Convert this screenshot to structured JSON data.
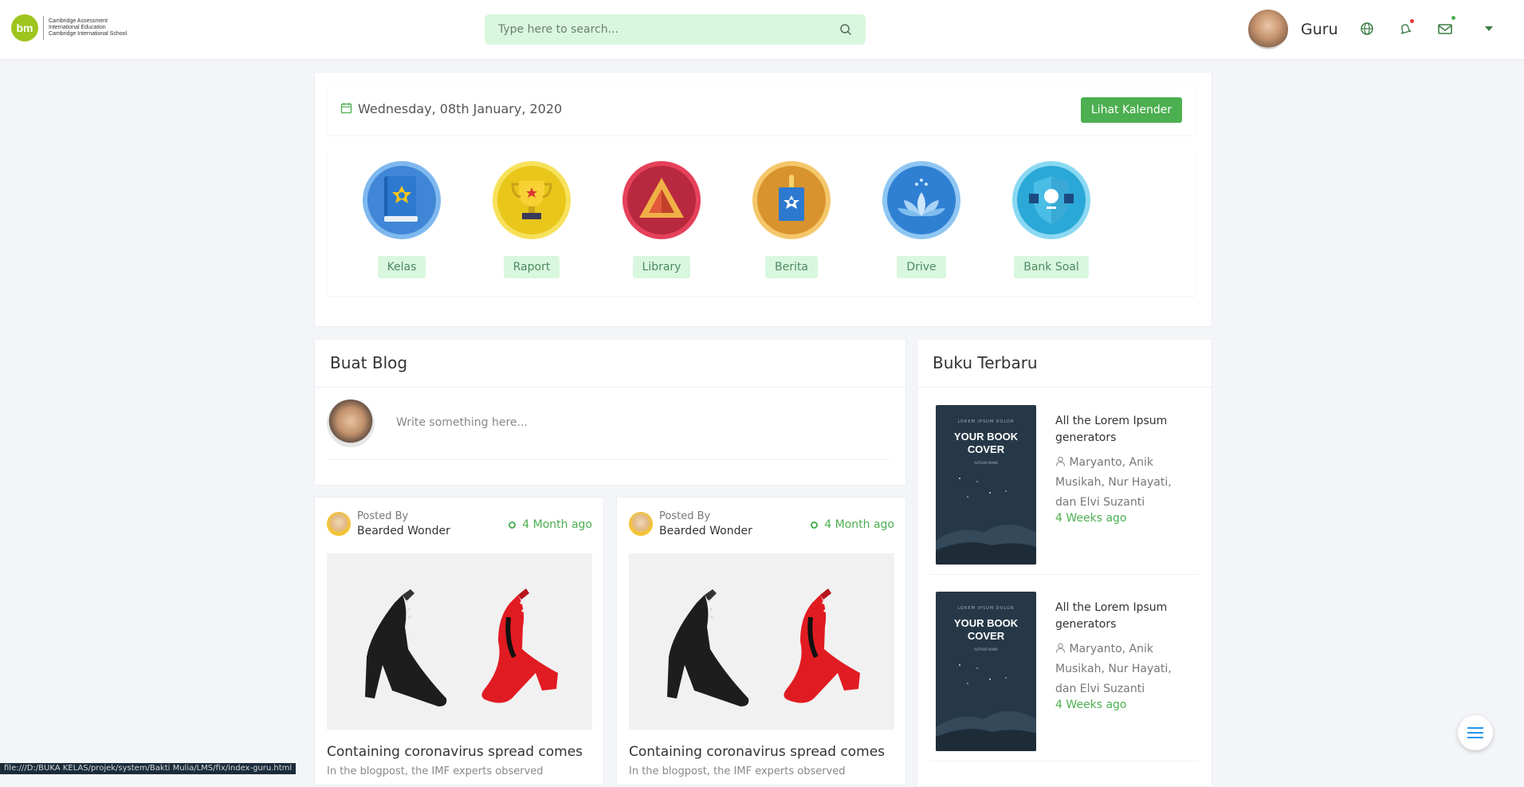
{
  "header": {
    "logo": {
      "mark": "bm",
      "line1": "Cambridge Assessment",
      "line2": "International Education",
      "line3": "Cambridge International School"
    },
    "search_placeholder": "Type here to search...",
    "user_name": "Guru"
  },
  "date_card": {
    "date": "Wednesday, 08th January, 2020",
    "calendar_button": "Lihat Kalender"
  },
  "apps": [
    {
      "label": "Kelas",
      "icon": "book-icon"
    },
    {
      "label": "Raport",
      "icon": "trophy-icon"
    },
    {
      "label": "Library",
      "icon": "triangle-icon"
    },
    {
      "label": "Berita",
      "icon": "badge-icon"
    },
    {
      "label": "Drive",
      "icon": "lotus-icon"
    },
    {
      "label": "Bank Soal",
      "icon": "shield-icon"
    }
  ],
  "blog": {
    "title": "Buat Blog",
    "placeholder": "Write something here..."
  },
  "posts": [
    {
      "posted_by": "Posted By",
      "author": "Bearded Wonder",
      "time": "4 Month ago",
      "title": "Containing coronavirus spread comes",
      "excerpt": "In the blogpost, the IMF experts observed"
    },
    {
      "posted_by": "Posted By",
      "author": "Bearded Wonder",
      "time": "4 Month ago",
      "title": "Containing coronavirus spread comes",
      "excerpt": "In the blogpost, the IMF experts observed"
    }
  ],
  "books": {
    "title": "Buku Terbaru",
    "items": [
      {
        "cover_top": "LOREM IPSUM DOLOR",
        "cover_title": "YOUR BOOK COVER",
        "cover_sub": "AUTHOR NAME",
        "title": "All the Lorem Ipsum generators",
        "authors": "Maryanto, Anik Musikah, Nur Hayati, dan Elvi Suzanti",
        "time": "4 Weeks ago"
      },
      {
        "cover_top": "LOREM IPSUM DOLOR",
        "cover_title": "YOUR BOOK COVER",
        "cover_sub": "AUTHOR NAME",
        "title": "All the Lorem Ipsum generators",
        "authors": "Maryanto, Anik Musikah, Nur Hayati, dan Elvi Suzanti",
        "time": "4 Weeks ago"
      }
    ]
  },
  "status_bar": "file:///D:/BUKA KELAS/projek/system/Bakti Mulia/LMS/fix/index-guru.html",
  "colors": {
    "accent": "#4caf50",
    "search_bg": "#d9f7df",
    "label_bg": "#d9f7df",
    "dot_red": "#e53935",
    "dot_green": "#4caf50"
  }
}
